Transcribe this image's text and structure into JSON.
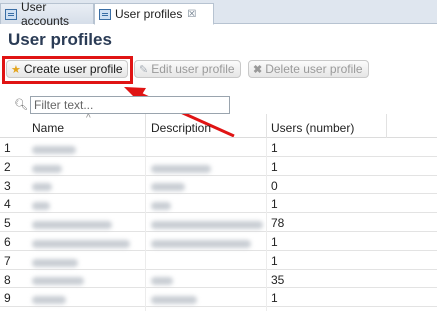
{
  "tabs": [
    {
      "label": "User accounts",
      "active": false
    },
    {
      "label": "User profiles",
      "active": true,
      "close_icon": "close-icon"
    }
  ],
  "page": {
    "title": "User profiles"
  },
  "toolbar": {
    "create_label": "Create user profile",
    "edit_label": "Edit user profile",
    "delete_label": "Delete user profile"
  },
  "filter": {
    "placeholder": "Filter text...",
    "value": ""
  },
  "table": {
    "columns": [
      "Name",
      "Description",
      "Users (number)"
    ],
    "rows": [
      {
        "index": "1",
        "users": "1"
      },
      {
        "index": "2",
        "users": "1"
      },
      {
        "index": "3",
        "users": "0"
      },
      {
        "index": "4",
        "users": "1"
      },
      {
        "index": "5",
        "users": "78"
      },
      {
        "index": "6",
        "users": "1"
      },
      {
        "index": "7",
        "users": "1"
      },
      {
        "index": "8",
        "users": "35"
      },
      {
        "index": "9",
        "users": "1"
      }
    ]
  },
  "colors": {
    "highlight": "#e01414",
    "title": "#2a3b55"
  }
}
